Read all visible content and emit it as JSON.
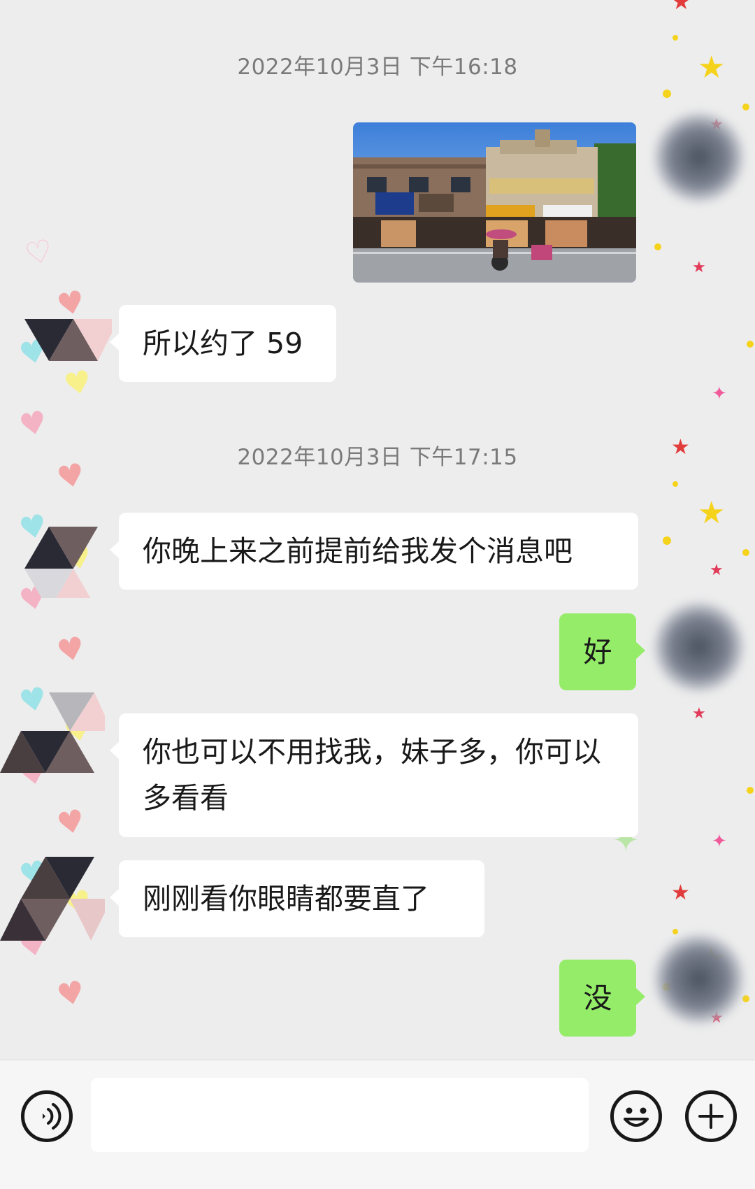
{
  "conversation": {
    "timestamps": [
      "2022年10月3日 下午16:18",
      "2022年10月3日 下午17:15"
    ],
    "messages": [
      {
        "side": "in",
        "text": "所以约了 59"
      },
      {
        "side": "in",
        "text": "你晚上来之前提前给我发个消息吧"
      },
      {
        "side": "out",
        "text": "好"
      },
      {
        "side": "in",
        "text": "你也可以不用找我，妹子多，你可以多看看"
      },
      {
        "side": "in",
        "text": "刚刚看你眼睛都要直了"
      },
      {
        "side": "out",
        "text": "没"
      }
    ]
  },
  "photo": {
    "type": "image",
    "description_icon": "storefront-photo"
  },
  "bottom_bar": {
    "voice_icon": "voice-icon",
    "emoji_icon": "emoji-icon",
    "plus_icon": "plus-icon",
    "input_value": ""
  },
  "colors": {
    "background": "#ededed",
    "incoming_bubble": "#ffffff",
    "outgoing_bubble": "#95ec69",
    "timestamp_text": "#7a7a7a"
  }
}
